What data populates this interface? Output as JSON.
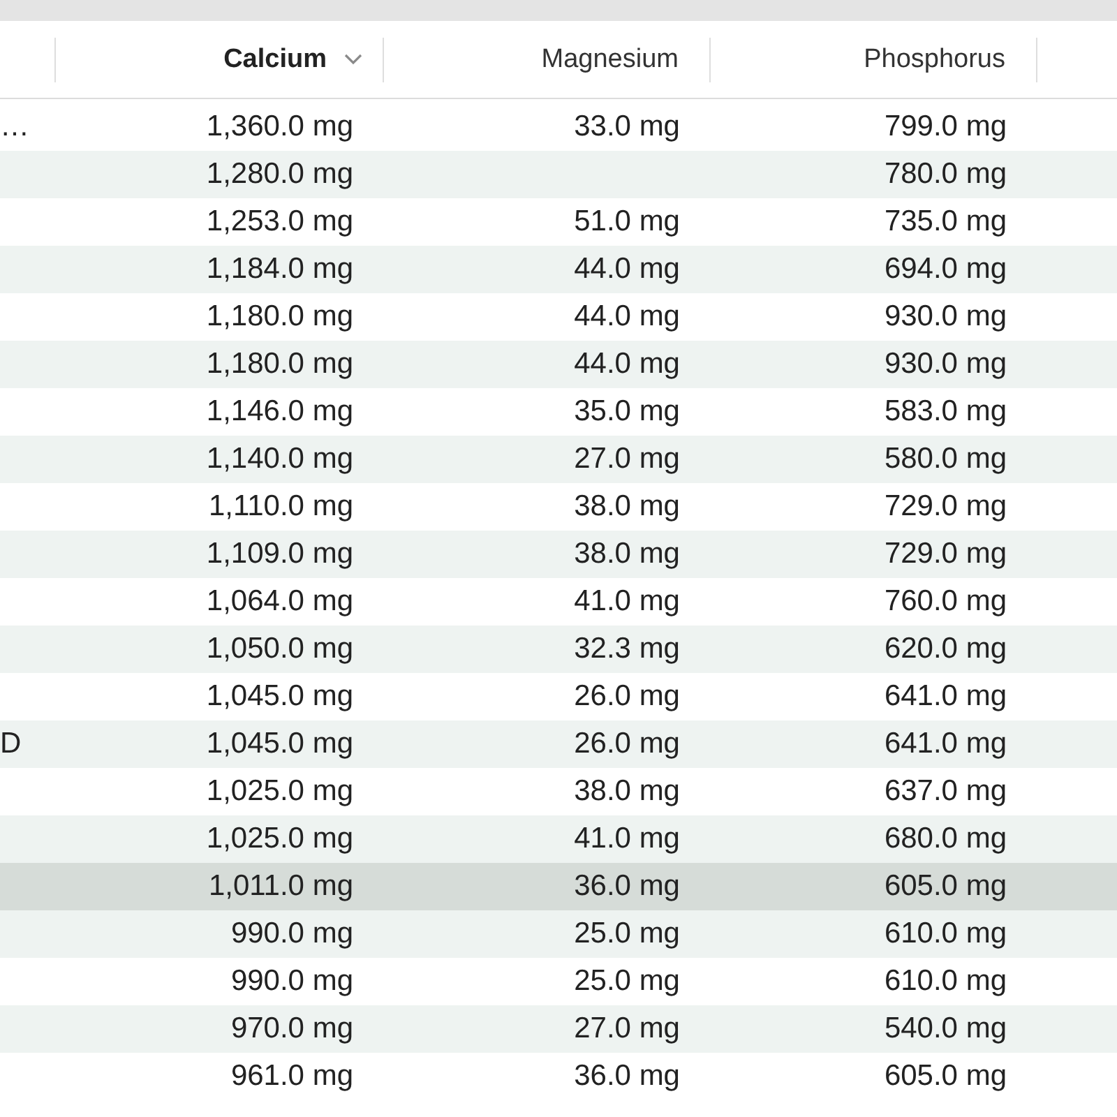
{
  "table": {
    "columns": [
      {
        "label": "Calcium",
        "sorted": true
      },
      {
        "label": "Magnesium",
        "sorted": false
      },
      {
        "label": "Phosphorus",
        "sorted": false
      }
    ],
    "rows": [
      {
        "column_1": "…",
        "calcium": "1,360.0 mg",
        "magnesium": "33.0 mg",
        "phosphorus": "799.0 mg",
        "selected": false
      },
      {
        "calcium": "1,280.0 mg",
        "phosphorus": "780.0 mg",
        "selected": false
      },
      {
        "calcium": "1,253.0 mg",
        "magnesium": "51.0 mg",
        "phosphorus": "735.0 mg",
        "selected": false
      },
      {
        "calcium": "1,184.0 mg",
        "magnesium": "44.0 mg",
        "phosphorus": "694.0 mg",
        "selected": false
      },
      {
        "calcium": "1,180.0 mg",
        "magnesium": "44.0 mg",
        "phosphorus": "930.0 mg",
        "selected": false
      },
      {
        "calcium": "1,180.0 mg",
        "magnesium": "44.0 mg",
        "phosphorus": "930.0 mg",
        "selected": false
      },
      {
        "calcium": "1,146.0 mg",
        "magnesium": "35.0 mg",
        "phosphorus": "583.0 mg",
        "selected": false
      },
      {
        "calcium": "1,140.0 mg",
        "magnesium": "27.0 mg",
        "phosphorus": "580.0 mg",
        "selected": false
      },
      {
        "calcium": "1,110.0 mg",
        "magnesium": "38.0 mg",
        "phosphorus": "729.0 mg",
        "selected": false
      },
      {
        "calcium": "1,109.0 mg",
        "magnesium": "38.0 mg",
        "phosphorus": "729.0 mg",
        "selected": false
      },
      {
        "calcium": "1,064.0 mg",
        "magnesium": "41.0 mg",
        "phosphorus": "760.0 mg",
        "selected": false
      },
      {
        "calcium": "1,050.0 mg",
        "magnesium": "32.3 mg",
        "phosphorus": "620.0 mg",
        "selected": false
      },
      {
        "calcium": "1,045.0 mg",
        "magnesium": "26.0 mg",
        "phosphorus": "641.0 mg",
        "selected": false
      },
      {
        "column_1": "D",
        "calcium": "1,045.0 mg",
        "magnesium": "26.0 mg",
        "phosphorus": "641.0 mg",
        "selected": false
      },
      {
        "calcium": "1,025.0 mg",
        "magnesium": "38.0 mg",
        "phosphorus": "637.0 mg",
        "selected": false
      },
      {
        "calcium": "1,025.0 mg",
        "magnesium": "41.0 mg",
        "phosphorus": "680.0 mg",
        "selected": false
      },
      {
        "calcium": "1,011.0 mg",
        "magnesium": "36.0 mg",
        "phosphorus": "605.0 mg",
        "selected": true
      },
      {
        "calcium": "990.0 mg",
        "magnesium": "25.0 mg",
        "phosphorus": "610.0 mg",
        "selected": false
      },
      {
        "calcium": "990.0 mg",
        "magnesium": "25.0 mg",
        "phosphorus": "610.0 mg",
        "selected": false
      },
      {
        "calcium": "970.0 mg",
        "magnesium": "27.0 mg",
        "phosphorus": "540.0 mg",
        "selected": false
      },
      {
        "calcium": "961.0 mg",
        "magnesium": "36.0 mg",
        "phosphorus": "605.0 mg",
        "selected": false
      }
    ]
  }
}
